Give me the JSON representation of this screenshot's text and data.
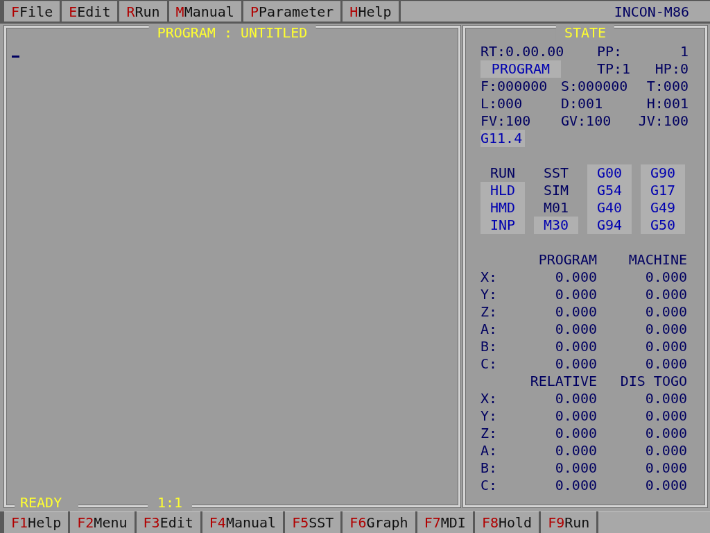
{
  "menu_bar": {
    "items": [
      {
        "key": "F",
        "label": "File"
      },
      {
        "key": "E",
        "label": "Edit"
      },
      {
        "key": "R",
        "label": "Run"
      },
      {
        "key": "M",
        "label": "Manual"
      },
      {
        "key": "P",
        "label": "Parameter"
      },
      {
        "key": "H",
        "label": "Help"
      }
    ],
    "brand": "INCON-M86"
  },
  "program_panel": {
    "title": "PROGRAM : UNTITLED",
    "status": "READY",
    "cursor_position": "1:1"
  },
  "state_panel": {
    "title": "STATE",
    "rt": "RT:0.00.00",
    "pp_label": "PP:",
    "pp_value": "1",
    "mode": {
      "label": "PROGRAM",
      "highlighted": true
    },
    "tp": "TP:1",
    "hp": "HP:0",
    "fields": [
      [
        "F:000000",
        "S:000000",
        "T:000"
      ],
      [
        "L:000",
        "D:001",
        "H:001"
      ],
      [
        "FV:100",
        "GV:100",
        "JV:100"
      ]
    ],
    "gcode": {
      "label": "G11.4",
      "highlighted": true
    },
    "indicators": [
      [
        {
          "label": "RUN",
          "highlighted": false
        },
        {
          "label": "HLD",
          "highlighted": true
        },
        {
          "label": "HMD",
          "highlighted": true
        },
        {
          "label": "INP",
          "highlighted": true
        }
      ],
      [
        {
          "label": "SST",
          "highlighted": false
        },
        {
          "label": "SIM",
          "highlighted": false
        },
        {
          "label": "M01",
          "highlighted": false
        },
        {
          "label": "M30",
          "highlighted": true
        }
      ],
      [
        {
          "label": "G00",
          "highlighted": true
        },
        {
          "label": "G54",
          "highlighted": true
        },
        {
          "label": "G40",
          "highlighted": true
        },
        {
          "label": "G94",
          "highlighted": true
        }
      ],
      [
        {
          "label": "G90",
          "highlighted": true
        },
        {
          "label": "G17",
          "highlighted": true
        },
        {
          "label": "G49",
          "highlighted": true
        },
        {
          "label": "G50",
          "highlighted": true
        }
      ]
    ],
    "positions": [
      {
        "headers": [
          "PROGRAM",
          "MACHINE"
        ],
        "rows": [
          {
            "axis": "X:",
            "values": [
              "0.000",
              "0.000"
            ]
          },
          {
            "axis": "Y:",
            "values": [
              "0.000",
              "0.000"
            ]
          },
          {
            "axis": "Z:",
            "values": [
              "0.000",
              "0.000"
            ]
          },
          {
            "axis": "A:",
            "values": [
              "0.000",
              "0.000"
            ]
          },
          {
            "axis": "B:",
            "values": [
              "0.000",
              "0.000"
            ]
          },
          {
            "axis": "C:",
            "values": [
              "0.000",
              "0.000"
            ]
          }
        ]
      },
      {
        "headers": [
          "RELATIVE",
          "DIS TOGO"
        ],
        "rows": [
          {
            "axis": "X:",
            "values": [
              "0.000",
              "0.000"
            ]
          },
          {
            "axis": "Y:",
            "values": [
              "0.000",
              "0.000"
            ]
          },
          {
            "axis": "Z:",
            "values": [
              "0.000",
              "0.000"
            ]
          },
          {
            "axis": "A:",
            "values": [
              "0.000",
              "0.000"
            ]
          },
          {
            "axis": "B:",
            "values": [
              "0.000",
              "0.000"
            ]
          },
          {
            "axis": "C:",
            "values": [
              "0.000",
              "0.000"
            ]
          }
        ]
      }
    ]
  },
  "function_keys": [
    {
      "key": "F1",
      "label": "Help"
    },
    {
      "key": "F2",
      "label": "Menu"
    },
    {
      "key": "F3",
      "label": "Edit"
    },
    {
      "key": "F4",
      "label": "Manual"
    },
    {
      "key": "F5",
      "label": "SST"
    },
    {
      "key": "F6",
      "label": "Graph"
    },
    {
      "key": "F7",
      "label": "MDI"
    },
    {
      "key": "F8",
      "label": "Hold"
    },
    {
      "key": "F9",
      "label": "Run"
    }
  ]
}
